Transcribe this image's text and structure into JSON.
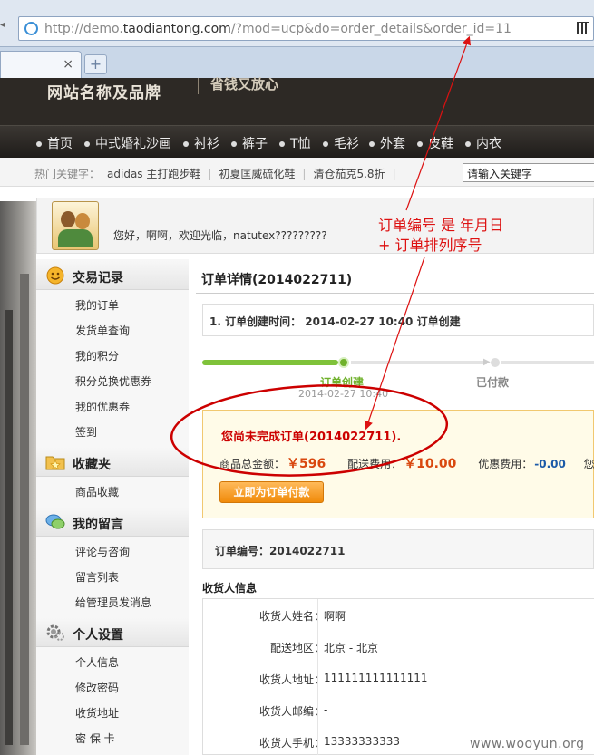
{
  "browser": {
    "url_prefix": "http://demo.",
    "url_host": "taodiantong.com",
    "url_path": "/?mod=ucp&do=order_details&order_id=11",
    "new_tab_symbol": "+",
    "close_tab_symbol": "×"
  },
  "site": {
    "brand": "网站名称及品牌",
    "slogan": "省钱又放心",
    "nav": [
      "首页",
      "中式婚礼沙画",
      "衬衫",
      "裤子",
      "T恤",
      "毛衫",
      "外套",
      "皮鞋",
      "内衣"
    ],
    "hot_label": "热门关键字：",
    "hot_keywords": [
      "adidas 主打跑步鞋",
      "初夏匡威硫化鞋",
      "清仓茄克5.8折"
    ],
    "search_placeholder": "请输入关键字"
  },
  "user": {
    "greeting": "您好，啊啊，欢迎光临，natutex?????????"
  },
  "sidebar": {
    "sections": [
      {
        "title": "交易记录",
        "icon": "smiley-icon",
        "items": [
          "我的订单",
          "发货单查询",
          "我的积分",
          "积分兑换优惠券",
          "我的优惠券",
          "签到"
        ]
      },
      {
        "title": "收藏夹",
        "icon": "folder-star-icon",
        "items": [
          "商品收藏"
        ]
      },
      {
        "title": "我的留言",
        "icon": "chat-bubble-icon",
        "items": [
          "评论与咨询",
          "留言列表",
          "给管理员发消息"
        ]
      },
      {
        "title": "个人设置",
        "icon": "gear-icon",
        "items": [
          "个人信息",
          "修改密码",
          "收货地址",
          "密 保 卡"
        ]
      }
    ]
  },
  "order": {
    "title": "订单详情(2014022711)",
    "log": "1. 订单创建时间： 2014-02-27 10:40 订单创建",
    "progress": {
      "step1": "订单创建",
      "step2": "已付款",
      "step1_date": "2014-02-27 10:40"
    },
    "notice": "您尚未完成订单(2014022711).",
    "goods_total_label": "商品总金额：",
    "goods_total": "￥596",
    "shipping_label": "配送费用：",
    "shipping": "￥10.00",
    "discount_label": "优惠费用：",
    "discount": "-0.00",
    "more_label": "您",
    "pay_button": "立即为订单付款",
    "order_no": "订单编号：2014022711"
  },
  "consignee": {
    "title": "收货人信息",
    "rows": [
      {
        "k": "收货人姓名：",
        "v": "啊啊"
      },
      {
        "k": "配送地区：",
        "v": "北京 - 北京"
      },
      {
        "k": "收货人地址：",
        "v": "111111111111111"
      },
      {
        "k": "收货人邮编：",
        "v": "-"
      },
      {
        "k": "收货人手机：",
        "v": "13333333333"
      }
    ]
  },
  "annotation": {
    "line1": "订单编号 是 年月日",
    "line2": "+ 订单排列序号",
    "color": "#dd1111"
  },
  "watermark": "www.wooyun.org"
}
